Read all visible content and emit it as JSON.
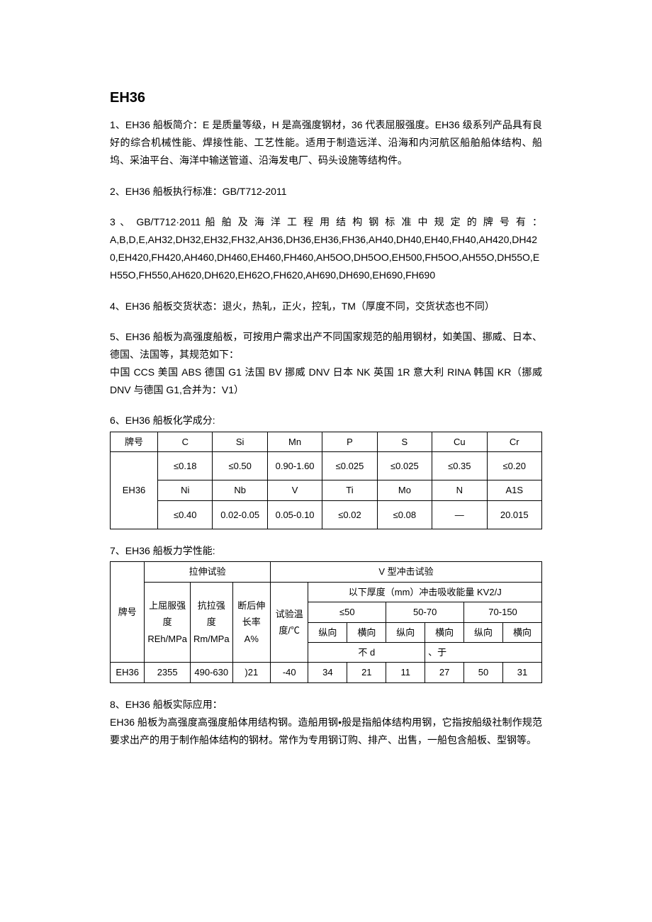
{
  "title": "EH36",
  "p1": "1、EH36 船板简介：E 是质量等级，H 是高强度钢材，36 代表屈服强度。EH36 级系列产品具有良好的综合机械性能、焊接性能、工艺性能。适用于制造远洋、沿海和内河航区船舶船体结构、船坞、采油平台、海洋中输送管道、沿海发电厂、码头设施等结构件。",
  "p2": "2、EH36 船板执行标准：GB/T712-2011",
  "p3a": "3 、 GB/T712·2011 船 舶 及 海 洋 工 程 用 结 构 钢 标 准 中 规 定 的 牌 号 有 ：",
  "p3b": "A,B,D,E,AH32,DH32,EH32,FH32,AH36,DH36,EH36,FH36,AH40,DH40,EH40,FH40,AH420,DH420,EH420,FH420,AH460,DH460,EH460,FH460,AH5OO,DH5OO,EH500,FH5OO,AH55O,DH55O,EH55O,FH550,AH620,DH620,EH62O,FH620,AH690,DH690,EH690,FH690",
  "p4": "4、EH36 船板交货状态：退火，热轧，正火，控轧，TM（厚度不同，交货状态也不同）",
  "p5": "5、EH36 船板为高强度船板，可按用户需求出产不同国家规范的船用钢材，如美国、挪威、日本、德国、法国等，其规范如下：",
  "p5b": "中国 CCS 美国 ABS 德国 G1 法国 BV 挪威 DNV 日本 NK 英国 1R 意大利 RINA 韩国 KR（挪威 DNV 与德国 G1,合并为：V1）",
  "p6": "6、EH36 船板化学成分:",
  "chem": {
    "header": [
      "牌号",
      "C",
      "Si",
      "Mn",
      "P",
      "S",
      "Cu",
      "Cr"
    ],
    "grade": "EH36",
    "row1": [
      "≤0.18",
      "≤0.50",
      "0.90-1.60",
      "≤0.025",
      "≤0.025",
      "≤0.35",
      "≤0.20"
    ],
    "sub": [
      "Ni",
      "Nb",
      "V",
      "Ti",
      "Mo",
      "N",
      "A1S"
    ],
    "row2": [
      "≤0.40",
      "0.02-0.05",
      "0.05-0.10",
      "≤0.02",
      "≤0.08",
      "—",
      "20.015"
    ]
  },
  "p7": "7、EH36 船板力学性能:",
  "mech": {
    "h_grade": "牌号",
    "h_tensile": "拉伸试验",
    "h_impact": "V 型冲击试验",
    "h_yield": "上屈服强度",
    "h_yield_u": "REh/MPa",
    "h_ts": "抗拉强度",
    "h_ts_u": "Rm/MPa",
    "h_elong": "断后伸长率 A%",
    "h_temp": "试验温度/℃",
    "h_energy": "以下厚度（mm）冲击吸收能量 KV2/J",
    "h_t1": "≤50",
    "h_t2": "50-70",
    "h_t3": "70-150",
    "h_long": "纵向",
    "h_trans": "横向",
    "h_notless_a": "不 d",
    "h_notless_b": "、于",
    "grade": "EH36",
    "vals": [
      "2355",
      "490-630",
      ")21",
      "-40",
      "34",
      "21",
      "11",
      "27",
      "50",
      "31"
    ]
  },
  "p8": "8、EH36 船板实际应用：",
  "p8b": "EH36 船板为高强度高强度船体用结构钢。造船用钢•般是指船体结构用钢，它指按船级社制作规范要求出产的用于制作船体结构的钢材。常作为专用钢订购、排产、出售，一船包含船板、型钢等。"
}
